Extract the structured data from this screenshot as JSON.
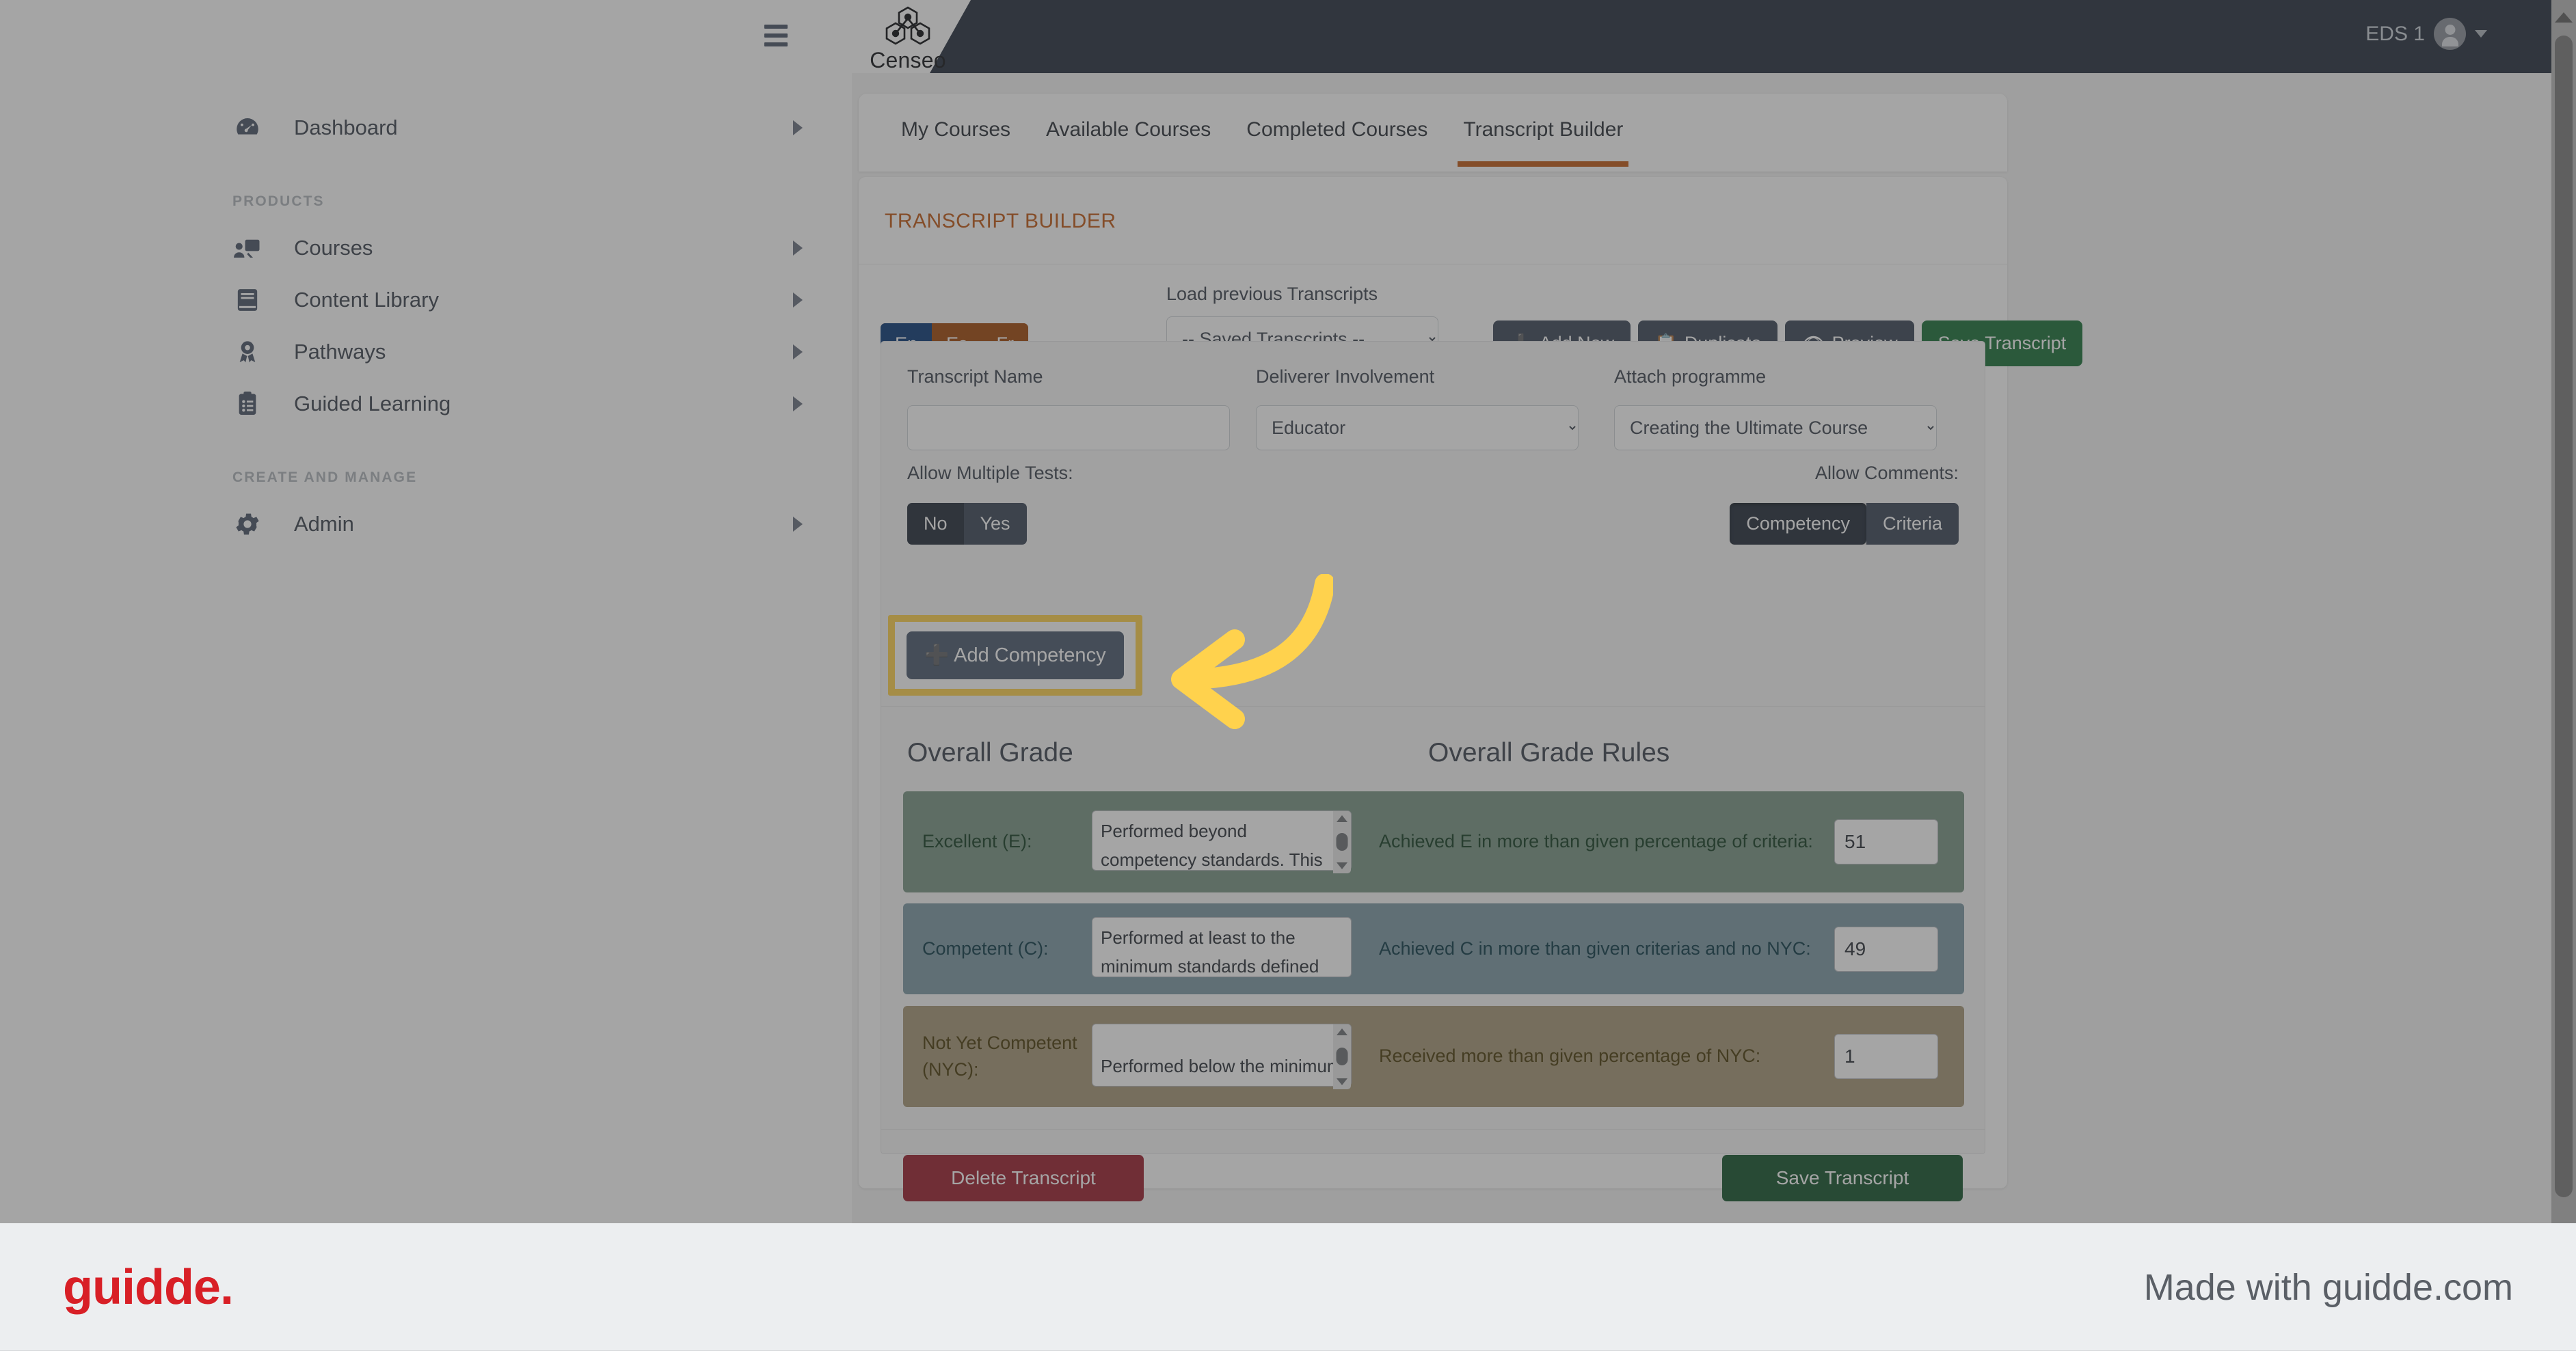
{
  "header": {
    "hamburger_icon": "hamburger-menu-icon",
    "logo_icon": "censeo-molecule-logo-icon",
    "logo_text": "Censeo",
    "user_name": "EDS 1",
    "avatar_icon": "user-avatar-icon",
    "caret_icon": "chevron-down-icon"
  },
  "sidebar": {
    "items": [
      {
        "label": "Dashboard",
        "icon": "dashboard-gauge-icon"
      },
      {
        "label": "Courses",
        "icon": "courses-presentation-icon"
      },
      {
        "label": "Content Library",
        "icon": "book-icon"
      },
      {
        "label": "Pathways",
        "icon": "award-ribbon-icon"
      },
      {
        "label": "Guided Learning",
        "icon": "clipboard-list-icon"
      },
      {
        "label": "Admin",
        "icon": "gear-icon"
      }
    ],
    "sections": {
      "products": "PRODUCTS",
      "create_and_manage": "CREATE AND MANAGE"
    },
    "chevron_icon": "chevron-right-icon"
  },
  "tabs": [
    {
      "label": "My Courses",
      "active": false
    },
    {
      "label": "Available Courses",
      "active": false
    },
    {
      "label": "Completed Courses",
      "active": false
    },
    {
      "label": "Transcript Builder",
      "active": true
    }
  ],
  "panel": {
    "title": "TRANSCRIPT BUILDER",
    "accent_color": "#c15a16"
  },
  "toolbar": {
    "languages": [
      {
        "label": "En",
        "active": true
      },
      {
        "label": "Es",
        "active": false
      },
      {
        "label": "Fr",
        "active": false
      }
    ],
    "load_label": "Load previous Transcripts",
    "saved_select_value": "-- Saved Transcripts --",
    "saved_select_options": [
      "-- Saved Transcripts --"
    ],
    "buttons": [
      {
        "label": "Add New",
        "icon": "plus-icon",
        "style": "dark"
      },
      {
        "label": "Duplicate",
        "icon": "copy-icon",
        "style": "dark"
      },
      {
        "label": "Preview",
        "icon": "eye-icon",
        "style": "dark"
      },
      {
        "label": "Save Transcript",
        "icon": "",
        "style": "green"
      }
    ]
  },
  "form": {
    "transcript_name_label": "Transcript Name",
    "transcript_name_value": "",
    "transcript_name_placeholder": "",
    "deliverer_label": "Deliverer Involvement",
    "deliverer_value": "Educator",
    "deliverer_options": [
      "Educator"
    ],
    "programme_label": "Attach programme",
    "programme_value": "Creating the Ultimate Course",
    "programme_options": [
      "Creating the Ultimate Course"
    ],
    "allow_tests_label": "Allow Multiple Tests:",
    "allow_tests_options": [
      {
        "label": "No",
        "active": true
      },
      {
        "label": "Yes",
        "active": false
      }
    ],
    "allow_comments_label": "Allow Comments:",
    "allow_comments_options": [
      {
        "label": "Competency",
        "active": true
      },
      {
        "label": "Criteria",
        "active": false
      }
    ],
    "add_competency_label": "Add Competency",
    "add_competency_icon": "plus-icon",
    "highlight_color": "#ffd24d"
  },
  "grades": {
    "heading_grade": "Overall Grade",
    "heading_rules": "Overall Grade Rules",
    "rows": [
      {
        "label": "Excellent (E):",
        "description": "Performed beyond competency standards. This individual will receive",
        "rule": "Achieved E in more than given percentage of criteria:",
        "value": "51",
        "color": "#7a9685"
      },
      {
        "label": "Competent (C):",
        "description": "Performed at least to the minimum standards defined by the competencies",
        "rule": "Achieved C in more than given criterias and no NYC:",
        "value": "49",
        "color": "#7d9aa4"
      },
      {
        "label": "Not Yet Competent (NYC):",
        "description": "Performed below the minimum",
        "rule": "Received more than given percentage of NYC:",
        "value": "1",
        "color": "#a69878"
      }
    ],
    "delete_label": "Delete Transcript",
    "save_label": "Save Transcript"
  },
  "footer": {
    "logo_text": "guidde.",
    "made_with": "Made with guidde.com",
    "logo_color": "#d81f26"
  },
  "scrollbar": {
    "up_icon": "scroll-up-arrow-icon"
  },
  "annotation": {
    "arrow_icon": "curved-arrow-pointing-left-icon",
    "arrow_color": "#ffd24d"
  }
}
